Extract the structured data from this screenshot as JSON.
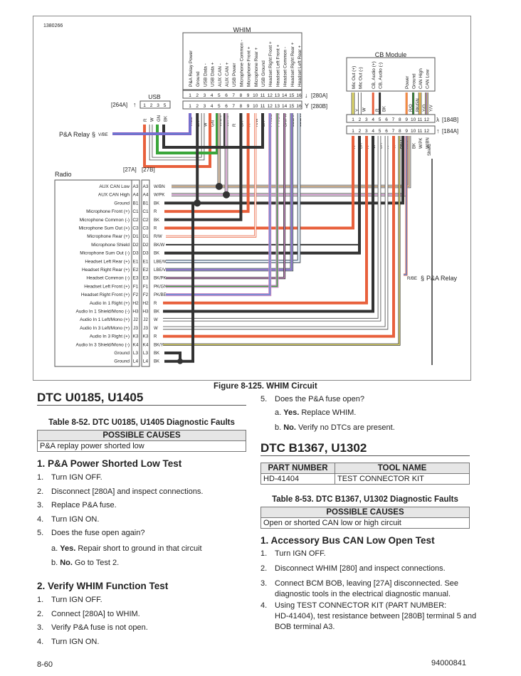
{
  "figure": {
    "id": "1380266",
    "caption": "Figure 8-125. WHIM Circuit",
    "whim": {
      "title": "WHIM",
      "pins": [
        "P&A Relay Power",
        "Ground",
        "USB Data -",
        "USB Data +",
        "AUX CAN -",
        "AUX CAN +",
        "USB Power",
        "Microphone Common -",
        "Microphone Front +",
        "Microphone Rear +",
        "USB Ground",
        "Headset Right Front +",
        "Headset Left Front +",
        "Headset Common -",
        "Headset Right Rear +",
        "Headset Left Rear +"
      ],
      "pin_numbers": [
        "1",
        "2",
        "3",
        "4",
        "5",
        "6",
        "7",
        "8",
        "9",
        "10",
        "11",
        "12",
        "13",
        "14",
        "15",
        "16"
      ],
      "connector_a": "[280A]",
      "connector_b": "[280B]",
      "wire_colors": [
        "V/BE",
        "BK",
        "W",
        "GN",
        "W/BN",
        "W/PK",
        "R",
        "BK",
        "R",
        "R/W",
        "BK",
        "PK/BE",
        "PK/GN",
        "BK/PK",
        "LBE/V",
        "LBE/W"
      ]
    },
    "usb": {
      "title": "USB",
      "connector": "[264A]",
      "pin_numbers": [
        "1",
        "2",
        "3",
        "5"
      ],
      "wire_colors": [
        "R",
        "W",
        "GN",
        "BK"
      ]
    },
    "pa_relay_left": {
      "label": "P&A Relay",
      "wire": "V/BE"
    },
    "pa_relay_right": {
      "label": "P&A Relay",
      "wire": "R/BE"
    },
    "cb_module": {
      "title": "CB Module",
      "pins": [
        "Mic Out (+)",
        "Mic Out (-)",
        "",
        "CB, Audio (+)",
        "CB, Audio (-)",
        "",
        "",
        "",
        "Power",
        "Ground",
        "CAN High",
        "CAN Low"
      ],
      "top_wire_colors": [
        "Y",
        "W",
        "",
        "R",
        "BK",
        "",
        "",
        "",
        "R/O",
        "BK/GN",
        "Y/O",
        "Y/V"
      ],
      "pin_numbers": [
        "1",
        "2",
        "3",
        "4",
        "5",
        "6",
        "7",
        "8",
        "9",
        "10",
        "11",
        "12"
      ],
      "connector_b": "[184B]",
      "connector_a": "[184A]",
      "bottom_wire_colors": [
        "R",
        "BK",
        "R",
        "W",
        "BK",
        "R",
        "W",
        "BK/Y",
        "R/BE",
        "BK",
        "W/PK",
        "W/BN"
      ],
      "shield_label": "Shield"
    },
    "radio": {
      "title": "Radio",
      "connector_a": "[27A]",
      "connector_b": "[27B]",
      "pins": [
        {
          "name": "AUX CAN Low",
          "pin": "A3",
          "wire": "W/BN"
        },
        {
          "name": "AUX CAN High",
          "pin": "A4",
          "wire": "W/PK"
        },
        {
          "name": "Ground",
          "pin": "B1",
          "wire": "BK"
        },
        {
          "name": "Microphone Front (+)",
          "pin": "C1",
          "wire": "R"
        },
        {
          "name": "Microphone Common (-)",
          "pin": "C2",
          "wire": "BK"
        },
        {
          "name": "Microphone Sum Out (+)",
          "pin": "C3",
          "wire": "R"
        },
        {
          "name": "Microphone Rear (+)",
          "pin": "D1",
          "wire": "R/W"
        },
        {
          "name": "Microphone Shield",
          "pin": "D2",
          "wire": "BK/W"
        },
        {
          "name": "Microphone Sum Out (-)",
          "pin": "D3",
          "wire": "BK"
        },
        {
          "name": "Headset Left Rear (+)",
          "pin": "E1",
          "wire": "LBE/W"
        },
        {
          "name": "Headset Right Rear (+)",
          "pin": "E2",
          "wire": "LBE/V"
        },
        {
          "name": "Headset Common (-)",
          "pin": "E3",
          "wire": "BK/PK"
        },
        {
          "name": "Headset Left Front (+)",
          "pin": "F1",
          "wire": "PK/GN"
        },
        {
          "name": "Headset Right Front (+)",
          "pin": "F2",
          "wire": "PK/BE"
        },
        {
          "name": "Audio In 1 Right (+)",
          "pin": "H2",
          "wire": "R"
        },
        {
          "name": "Audio In 1 Shield/Mono (-)",
          "pin": "H3",
          "wire": "BK"
        },
        {
          "name": "Audio In 1 Left/Mono (+)",
          "pin": "J2",
          "wire": "W"
        },
        {
          "name": "Audio In 3 Left/Mono (+)",
          "pin": "J3",
          "wire": "W"
        },
        {
          "name": "Audio In 3 Right (+)",
          "pin": "K3",
          "wire": "R"
        },
        {
          "name": "Audio In 3 Shield/Mono (-)",
          "pin": "K4",
          "wire": "BK/Y"
        },
        {
          "name": "Ground",
          "pin": "L3",
          "wire": "BK"
        },
        {
          "name": "Ground",
          "pin": "L4",
          "wire": "BK"
        }
      ]
    },
    "wire_palette": {
      "R": "#e8603c",
      "BK": "#333333",
      "W": "#ffffff",
      "GN": "#3aa63a",
      "V": "#8a5cc4",
      "BN": "#b08b62",
      "PK": "#c98ac4",
      "Y": "#e8e070",
      "LBE": "#a6c4e6",
      "O": "#f0a040",
      "BE": "#5a8ad6"
    }
  },
  "left_column": {
    "dtc_heading": "DTC U0185, U1405",
    "table_title": "Table 8-52. DTC U0185, U1405 Diagnostic Faults",
    "table_header": "POSSIBLE CAUSES",
    "table_row": "P&A replay power shorted low",
    "test1": {
      "heading": "1. P&A Power Shorted Low Test",
      "steps": [
        {
          "num": "1.",
          "text": "Turn IGN OFF."
        },
        {
          "num": "2.",
          "text": "Disconnect [280A] and inspect connections."
        },
        {
          "num": "3.",
          "text": "Replace P&A fuse."
        },
        {
          "num": "4.",
          "text": "Turn IGN ON."
        },
        {
          "num": "5.",
          "text": "Does the fuse open again?"
        }
      ],
      "answers": [
        {
          "letter": "a.",
          "bold": "Yes.",
          "text": " Repair short to ground in that circuit"
        },
        {
          "letter": "b.",
          "bold": "No.",
          "text": " Go to Test 2."
        }
      ]
    },
    "test2": {
      "heading": "2. Verify WHIM Function Test",
      "steps": [
        {
          "num": "1.",
          "text": "Turn IGN OFF."
        },
        {
          "num": "2.",
          "text": "Connect [280A] to WHIM."
        },
        {
          "num": "3.",
          "text": "Verify P&A fuse is not open."
        },
        {
          "num": "4.",
          "text": "Turn IGN ON."
        }
      ]
    }
  },
  "right_column": {
    "continued_step": {
      "num": "5.",
      "text": "Does the P&A fuse open?"
    },
    "answers": [
      {
        "letter": "a.",
        "bold": "Yes.",
        "text": " Replace WHIM."
      },
      {
        "letter": "b.",
        "bold": "No.",
        "text": " Verify no DTCs are present."
      }
    ],
    "dtc_heading": "DTC B1367, U1302",
    "tool_table": {
      "headers": [
        "PART NUMBER",
        "TOOL NAME"
      ],
      "rows": [
        [
          "HD-41404",
          "TEST CONNECTOR KIT"
        ]
      ]
    },
    "table_title": "Table 8-53. DTC B1367, U1302 Diagnostic Faults",
    "table_header": "POSSIBLE CAUSES",
    "table_row": "Open or shorted CAN low or high circuit",
    "test1": {
      "heading": "1. Accessory Bus CAN Low Open Test",
      "steps": [
        {
          "num": "1.",
          "text": "Turn IGN OFF."
        },
        {
          "num": "2.",
          "text": "Disconnect WHIM [280] and inspect connections."
        },
        {
          "num": "3.",
          "text": "Connect BCM BOB, leaving [27A] disconnected. See",
          "text2": "diagnostic tools in the electrical diagnostic manual."
        },
        {
          "num": "4.",
          "text": "Using TEST CONNECTOR KIT (PART NUMBER:",
          "text2": "HD-41404), test resistance between [280B] terminal 5 and",
          "text3": "BOB terminal A3."
        }
      ]
    }
  },
  "footer": {
    "page_number": "8-60",
    "doc_number": "94000841"
  }
}
